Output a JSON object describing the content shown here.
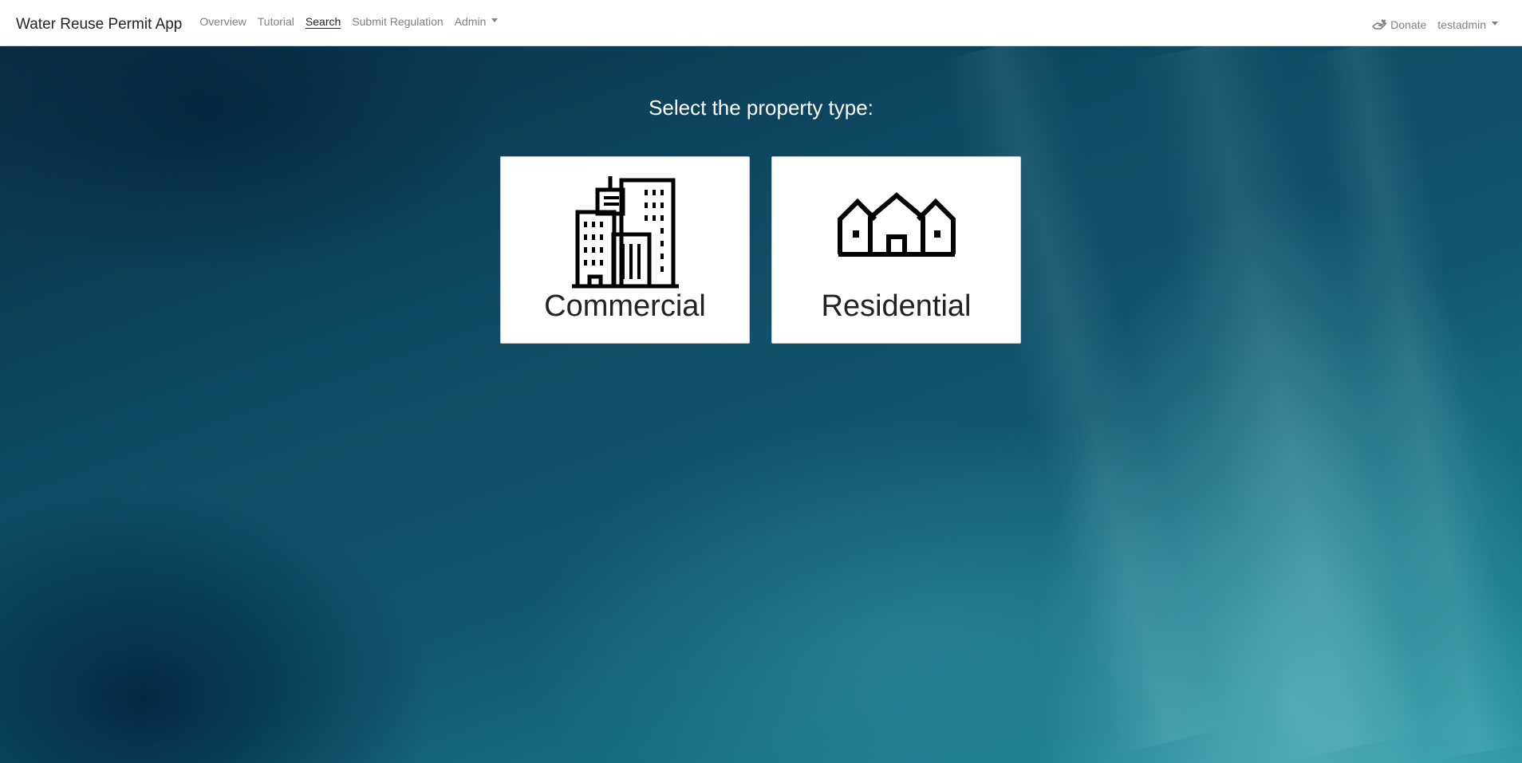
{
  "navbar": {
    "brand": "Water Reuse Permit App",
    "links": [
      {
        "label": "Overview"
      },
      {
        "label": "Tutorial"
      },
      {
        "label": "Search"
      },
      {
        "label": "Submit Regulation"
      }
    ],
    "admin_label": "Admin",
    "donate_label": "Donate",
    "user_label": "testadmin",
    "active_link": "Search"
  },
  "main": {
    "prompt": "Select the property type:",
    "options": [
      {
        "label": "Commercial",
        "icon": "office-buildings-icon"
      },
      {
        "label": "Residential",
        "icon": "houses-icon"
      }
    ]
  },
  "colors": {
    "navbar_bg": "#ffffff",
    "nav_text": "#7d8288",
    "active_text": "#212529",
    "card_bg": "#ffffff",
    "background": "#0f4a63"
  }
}
